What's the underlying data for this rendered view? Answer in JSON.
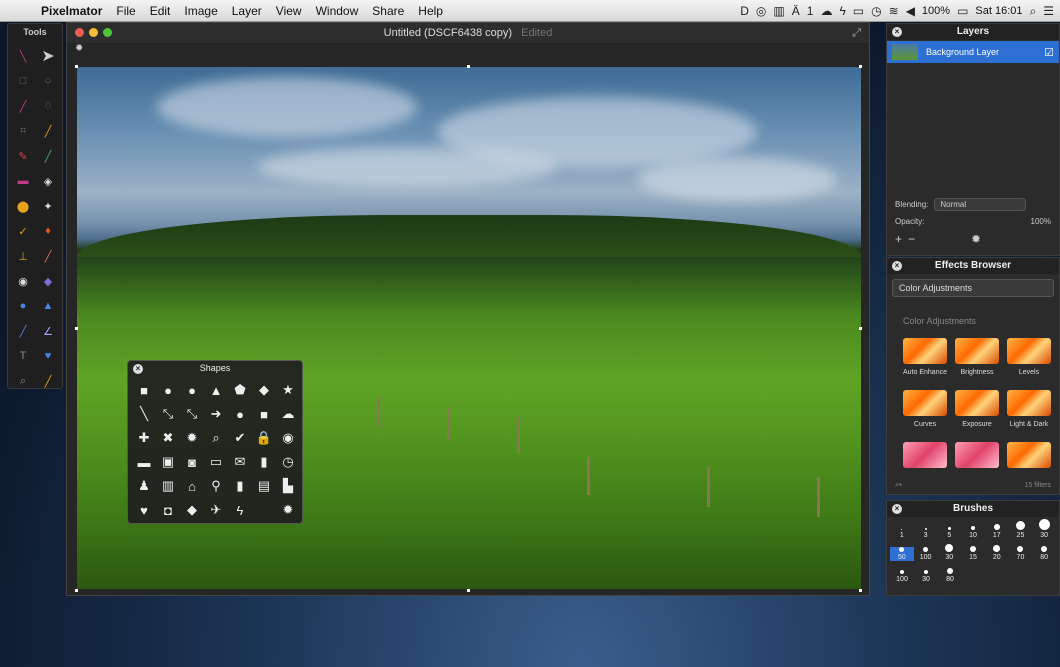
{
  "menubar": {
    "app": "Pixelmator",
    "items": [
      "File",
      "Edit",
      "Image",
      "Layer",
      "View",
      "Window",
      "Share",
      "Help"
    ],
    "battery": "100%",
    "clock": "Sat 16:01",
    "badge": "1"
  },
  "tools": {
    "title": "Tools"
  },
  "document": {
    "title": "Untitled (DSCF6438 copy)",
    "status": "Edited"
  },
  "shapes": {
    "title": "Shapes",
    "icons": [
      "■",
      "●",
      "●",
      "▲",
      "⬟",
      "◆",
      "★",
      "╲",
      "⤡",
      "⤡",
      "➜",
      "●",
      "■",
      "☁",
      "✚",
      "✖",
      "✹",
      "⌕",
      "✔",
      "🔒",
      "◉",
      "▬",
      "▣",
      "◙",
      "▭",
      "✉",
      "▮",
      "◷",
      "♟",
      "▥",
      "⌂",
      "⚲",
      "▮",
      "▤",
      "▙",
      "♥",
      "◘",
      "◆",
      "✈",
      "ϟ",
      "",
      ""
    ]
  },
  "layers": {
    "title": "Layers",
    "layer_name": "Background Layer",
    "blending_label": "Blending:",
    "blending_value": "Normal",
    "opacity_label": "Opacity:",
    "opacity_value": "100%"
  },
  "effects": {
    "title": "Effects Browser",
    "dropdown": "Color Adjustments",
    "subtitle": "Color Adjustments",
    "filters": [
      "Auto Enhance",
      "Brightness",
      "Levels",
      "Curves",
      "Exposure",
      "Light & Dark"
    ],
    "count": "15 filters"
  },
  "brushes": {
    "title": "Brushes",
    "row1": [
      "1",
      "3",
      "5",
      "10",
      "17",
      "25",
      "30"
    ],
    "row2": [
      "50",
      "100",
      "30",
      "15",
      "20",
      "70",
      "80"
    ],
    "row3": [
      "100",
      "30",
      "80"
    ]
  }
}
